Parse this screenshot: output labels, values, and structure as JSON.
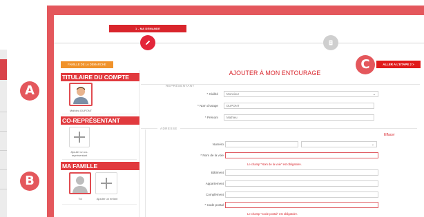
{
  "stepper": {
    "step1_label": "1 - MA DEMANDE"
  },
  "buttons": {
    "parent_label": "FAMILLE DE LA DÉMARCHE",
    "next_label": "ALLER A L'ETAPE 2 >"
  },
  "sidebar": {
    "titulaire_title": "TITULAIRE DU COMPTE",
    "titulaire_name": "Mathieu DUPONT",
    "corep_title": "CO-REPRÉSENTANT",
    "corep_caption": "Ajouter un co-représentant",
    "famille_title": "MA FAMILLE",
    "famille_self": "Toi",
    "famille_add": "Ajouter un enfant"
  },
  "form": {
    "title": "AJOUTER À MON ENTOURAGE",
    "rep_section": "REPRÉSENTANT",
    "civilite_label": "* Civilité",
    "civilite_value": "Monsieur",
    "nom_usage_label": "* Nom d'usage",
    "nom_usage_value": "DUPONT",
    "prenom_label": "* Prénom",
    "prenom_value": "Mathieu",
    "adresse_section": "ADRESSE",
    "effacer": "Effacer",
    "numero_label": "Numéro",
    "nom_voie_label": "* Nom de la voie",
    "nom_voie_error": "Le champ \"Nom de la voie\" est obligatoire.",
    "batiment_label": "Bâtiment",
    "appartement_label": "Appartement",
    "complement_label": "Complément",
    "code_postal_label": "* Code postal",
    "code_postal_error": "Le champ \"Code postal\" est obligatoire."
  },
  "callouts": {
    "a": "A",
    "b": "B",
    "c": "C"
  },
  "colors": {
    "frame": "#e4575c",
    "accent": "#d9252c",
    "orange": "#f0922b"
  }
}
